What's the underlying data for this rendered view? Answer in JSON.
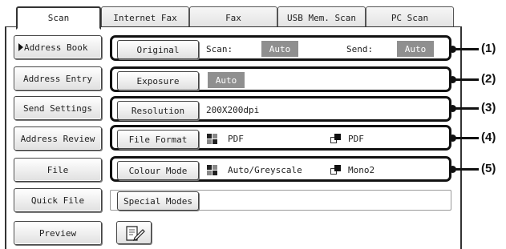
{
  "tabs": [
    {
      "label": "Scan",
      "active": true
    },
    {
      "label": "Internet Fax"
    },
    {
      "label": "Fax"
    },
    {
      "label": "USB Mem. Scan"
    },
    {
      "label": "PC Scan"
    }
  ],
  "left_buttons": [
    {
      "label": "Address Book",
      "selected": true
    },
    {
      "label": "Address Entry"
    },
    {
      "label": "Send Settings"
    },
    {
      "label": "Address Review"
    },
    {
      "label": "File"
    },
    {
      "label": "Quick File"
    },
    {
      "label": "Preview"
    }
  ],
  "settings": {
    "original": {
      "button": "Original",
      "scan_label": "Scan:",
      "scan_value": "Auto",
      "send_label": "Send:",
      "send_value": "Auto"
    },
    "exposure": {
      "button": "Exposure",
      "value": "Auto"
    },
    "resolution": {
      "button": "Resolution",
      "value": "200X200dpi"
    },
    "file_format": {
      "button": "File Format",
      "colour_value": "PDF",
      "mono_value": "PDF"
    },
    "colour_mode": {
      "button": "Colour Mode",
      "colour_value": "Auto/Greyscale",
      "mono_value": "Mono2"
    },
    "special_modes": {
      "button": "Special Modes"
    }
  },
  "callouts": [
    "(1)",
    "(2)",
    "(3)",
    "(4)",
    "(5)"
  ],
  "colors": {
    "badge": "#8f8f8f",
    "frame": "#111111"
  }
}
